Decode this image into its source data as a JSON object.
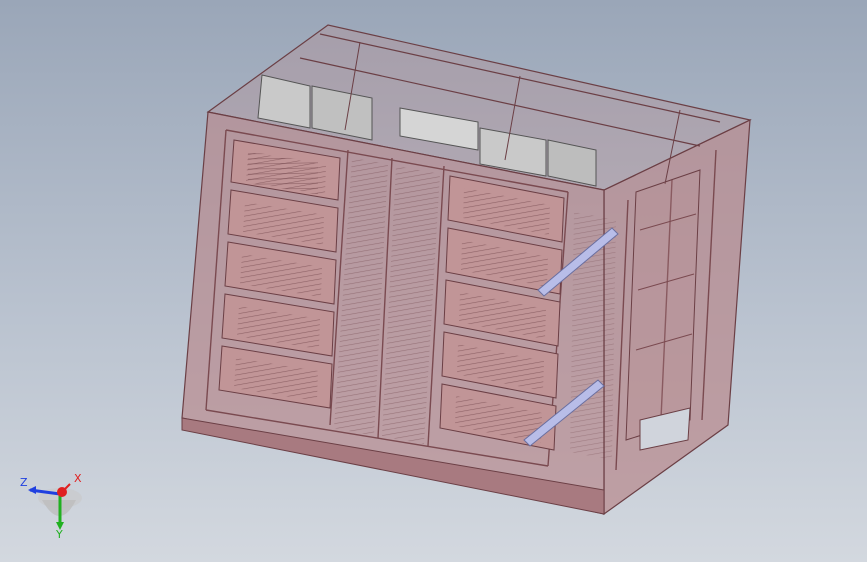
{
  "viewport": {
    "background_top": "#9aa6b8",
    "background_bottom": "#d3d8df"
  },
  "model": {
    "enclosure_color": "#b88c90",
    "enclosure_edge": "#6b3f45",
    "frame_color": "#8a5a60",
    "panel_color": "#c9c9c9",
    "accent_color": "#b8bde8"
  },
  "triad": {
    "x_label": "X",
    "y_label": "Y",
    "z_label": "Z",
    "x_color": "#e02020",
    "y_color": "#20b020",
    "z_color": "#2040e0"
  }
}
